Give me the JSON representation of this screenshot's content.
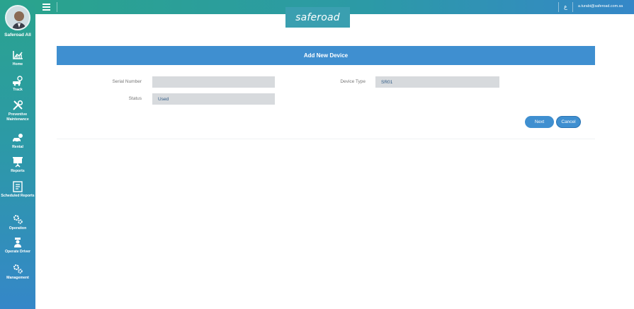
{
  "sidebar": {
    "user_name": "Saferoad All",
    "items": [
      {
        "label": "Home",
        "icon": "chart-icon"
      },
      {
        "label": "Track",
        "icon": "track-icon"
      },
      {
        "label": "Preventive Maintenance",
        "icon": "tools-icon"
      },
      {
        "label": "Rental",
        "icon": "rental-car-icon"
      },
      {
        "label": "Reports",
        "icon": "presentation-board-icon"
      },
      {
        "label": "Scheduled Reports",
        "icon": "scheduled-report-icon"
      },
      {
        "label": "Operation",
        "icon": "gears-icon"
      },
      {
        "label": "Operate Driver",
        "icon": "driver-icon"
      },
      {
        "label": "Management",
        "icon": "gears-icon"
      }
    ]
  },
  "topbar": {
    "lang_glyph": "ع",
    "user_email": "a.turabi@saferoad.com.sa"
  },
  "logo": {
    "text": "saferoad"
  },
  "form": {
    "title": "Add New Device",
    "serial_number": {
      "label": "Serial Number",
      "value": ""
    },
    "device_type": {
      "label": "Device Type",
      "value": "SR01"
    },
    "status": {
      "label": "Status",
      "value": "Used"
    }
  },
  "buttons": {
    "next": "Next",
    "cancel": "Cancel"
  },
  "colors": {
    "accent": "#3f8fd0",
    "sidebar_top": "#2aa38e",
    "sidebar_bottom": "#3587c8",
    "input_bg": "#d7dadd"
  }
}
